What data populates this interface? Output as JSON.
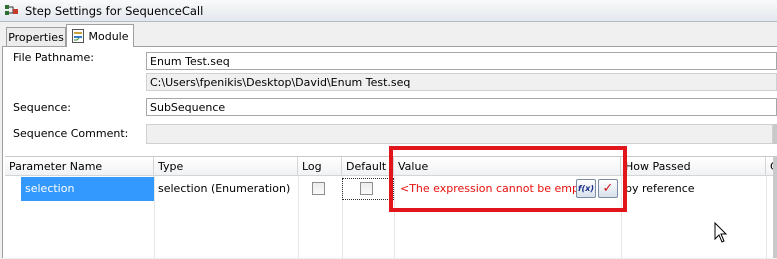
{
  "window": {
    "title": "Step Settings for SequenceCall"
  },
  "tabs": [
    {
      "label": "Properties"
    },
    {
      "label": "Module"
    }
  ],
  "form": {
    "file_pathname_label": "File Pathname:",
    "file_pathname_value": "Enum Test.seq",
    "file_full_path": "C:\\Users\\fpenikis\\Desktop\\David\\Enum Test.seq",
    "sequence_label": "Sequence:",
    "sequence_value": "SubSequence",
    "sequence_comment_label": "Sequence Comment:",
    "sequence_comment_value": ""
  },
  "grid": {
    "columns": [
      "Parameter Name",
      "Type",
      "Log",
      "Default",
      "Value",
      "How Passed",
      "C"
    ],
    "rows": [
      {
        "parameter_name": "selection",
        "type": "selection (Enumeration)",
        "log": false,
        "default": false,
        "value": "<The expression cannot be empty.>",
        "how_passed": "by reference"
      }
    ],
    "value_buttons": {
      "expression_icon": "f(x)",
      "check_icon": "✓"
    }
  },
  "colors": {
    "error_text": "#e8100d",
    "highlight_border": "#e0161c",
    "selection": "#3399ff"
  }
}
